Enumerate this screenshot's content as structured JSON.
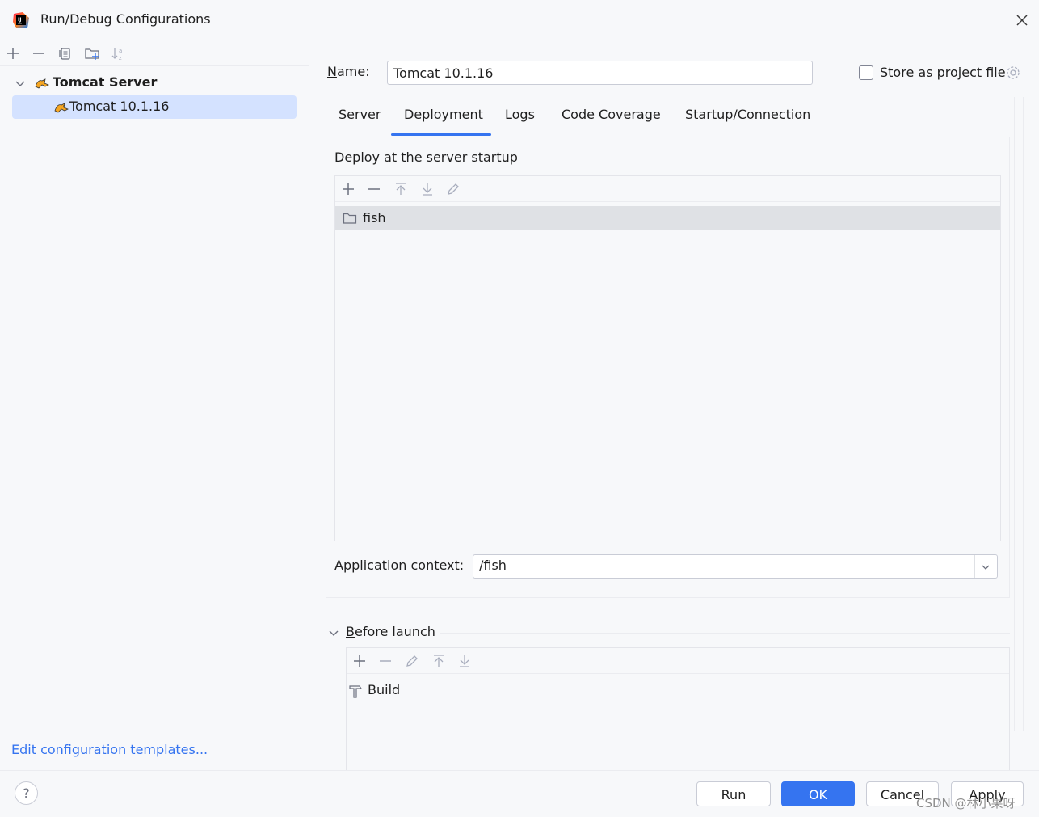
{
  "window": {
    "title": "Run/Debug Configurations",
    "app_icon": "intellij-idea-icon",
    "close_icon": "close-icon"
  },
  "sidebar": {
    "toolbar": [
      "add-icon",
      "remove-icon",
      "copy-icon",
      "new-folder-icon",
      "sort-icon"
    ],
    "tree": {
      "group_label": "Tomcat Server",
      "group_icon": "tomcat-icon",
      "items": [
        {
          "label": "Tomcat 10.1.16",
          "icon": "tomcat-icon",
          "selected": true
        }
      ]
    },
    "edit_templates_link": "Edit configuration templates..."
  },
  "form": {
    "name_label_mnemonic": "N",
    "name_label_rest": "ame:",
    "name_value": "Tomcat 10.1.16",
    "store_label": "Store as project file",
    "store_checked": false
  },
  "tabs": [
    {
      "label": "Server",
      "active": false
    },
    {
      "label": "Deployment",
      "active": true
    },
    {
      "label": "Logs",
      "active": false
    },
    {
      "label": "Code Coverage",
      "active": false
    },
    {
      "label": "Startup/Connection",
      "active": false
    }
  ],
  "deployment": {
    "section_title": "Deploy at the server startup",
    "toolbar": [
      "add-icon",
      "remove-icon",
      "move-up-icon",
      "move-down-icon",
      "edit-icon"
    ],
    "artifacts": [
      {
        "label": "fish",
        "icon": "folder-icon"
      }
    ],
    "app_context_label": "Application context:",
    "app_context_value": "/fish"
  },
  "before_launch": {
    "label_mnemonic": "B",
    "label_rest": "efore launch",
    "expanded": true,
    "toolbar": [
      "add-icon",
      "remove-icon",
      "edit-icon",
      "move-up-icon",
      "move-down-icon"
    ],
    "tasks": [
      {
        "label": "Build",
        "icon": "build-hammer-icon"
      }
    ]
  },
  "footer": {
    "help_label": "?",
    "run_label": "Run",
    "ok_label": "OK",
    "cancel_label": "Cancel",
    "apply_label": "Apply"
  },
  "watermark": "CSDN @林小果呀",
  "colors": {
    "accent": "#3574f0",
    "selection": "#d4e2ff",
    "row_highlight": "#dfe1e5",
    "background": "#f7f8fa"
  }
}
